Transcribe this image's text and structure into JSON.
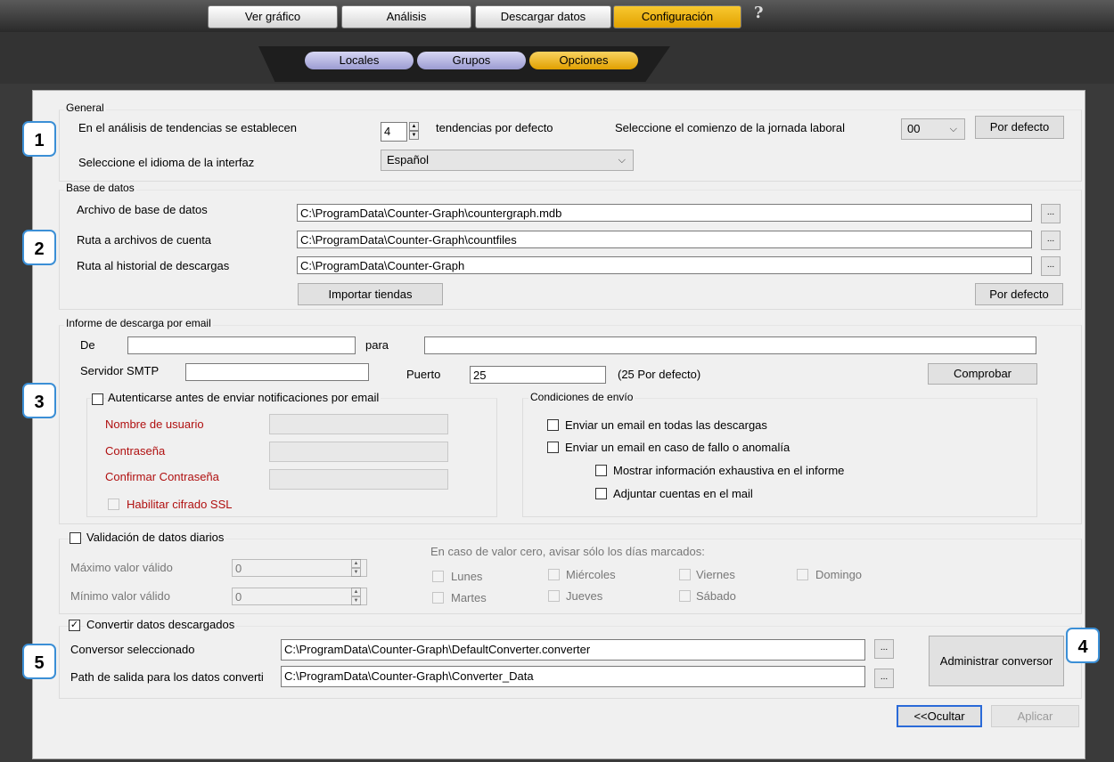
{
  "top_tabs": [
    {
      "label": "Ver gráfico"
    },
    {
      "label": "Análisis"
    },
    {
      "label": "Descargar datos"
    },
    {
      "label": "Configuración"
    }
  ],
  "help_label": "?",
  "sub_tabs": [
    {
      "label": "Locales"
    },
    {
      "label": "Grupos"
    },
    {
      "label": "Opciones"
    }
  ],
  "badges": [
    "1",
    "2",
    "3",
    "4",
    "5"
  ],
  "general": {
    "legend": "General",
    "trends_label": "En el análisis de tendencias se establecen",
    "trends_value": "4",
    "trends_suffix": "tendencias por defecto",
    "workday_label": "Seleccione el comienzo de la jornada laboral",
    "workday_value": "00",
    "default_button": "Por defecto",
    "language_label": "Seleccione el idioma de la interfaz",
    "language_value": "Español"
  },
  "database": {
    "legend": "Base de datos",
    "rows": [
      {
        "label": "Archivo de base de datos",
        "value": "C:\\ProgramData\\Counter-Graph\\countergraph.mdb"
      },
      {
        "label": "Ruta a archivos de cuenta",
        "value": "C:\\ProgramData\\Counter-Graph\\countfiles"
      },
      {
        "label": "Ruta al historial de descargas",
        "value": "C:\\ProgramData\\Counter-Graph"
      }
    ],
    "browse_label": "...",
    "import_button": "Importar tiendas",
    "default_button": "Por defecto"
  },
  "email": {
    "legend": "Informe de descarga por email",
    "from_label": "De",
    "from_value": "",
    "to_label": "para",
    "to_value": "",
    "smtp_label": "Servidor SMTP",
    "smtp_value": "",
    "port_label": "Puerto",
    "port_value": "25",
    "port_hint": "(25 Por defecto)",
    "check_button": "Comprobar",
    "auth_label": "Autenticarse antes de enviar notificaciones por email",
    "username_label": "Nombre de usuario",
    "password_label": "Contraseña",
    "confirm_label": "Confirmar Contraseña",
    "ssl_label": "Habilitar cifrado SSL",
    "conditions_legend": "Condiciones de envío",
    "cond_all": "Enviar un email en todas las descargas",
    "cond_fail": "Enviar un email en caso de fallo o anomalía",
    "cond_exhaustive": "Mostrar información exhaustiva en el informe",
    "cond_attach": "Adjuntar cuentas en el mail"
  },
  "validation": {
    "legend": "Validación de datos diarios",
    "max_label": "Máximo valor válido",
    "max_value": "0",
    "min_label": "Mínimo valor válido",
    "min_value": "0",
    "zero_note": "En caso de valor cero, avisar sólo los días marcados:",
    "days": [
      "Lunes",
      "Martes",
      "Miércoles",
      "Jueves",
      "Viernes",
      "Sábado",
      "Domingo"
    ]
  },
  "converter": {
    "legend": "Convertir datos descargados",
    "checked": true,
    "check_mark": "✓",
    "selected_label": "Conversor seleccionado",
    "selected_value": "C:\\ProgramData\\Counter-Graph\\DefaultConverter.converter",
    "output_label": "Path de salida para los datos converti",
    "output_value": "C:\\ProgramData\\Counter-Graph\\Converter_Data",
    "manage_button": "Administrar conversor"
  },
  "footer": {
    "hide_button": "<<Ocultar",
    "apply_button": "Aplicar"
  },
  "spin_up": "▲",
  "spin_down": "▼",
  "chevron": "⌵"
}
